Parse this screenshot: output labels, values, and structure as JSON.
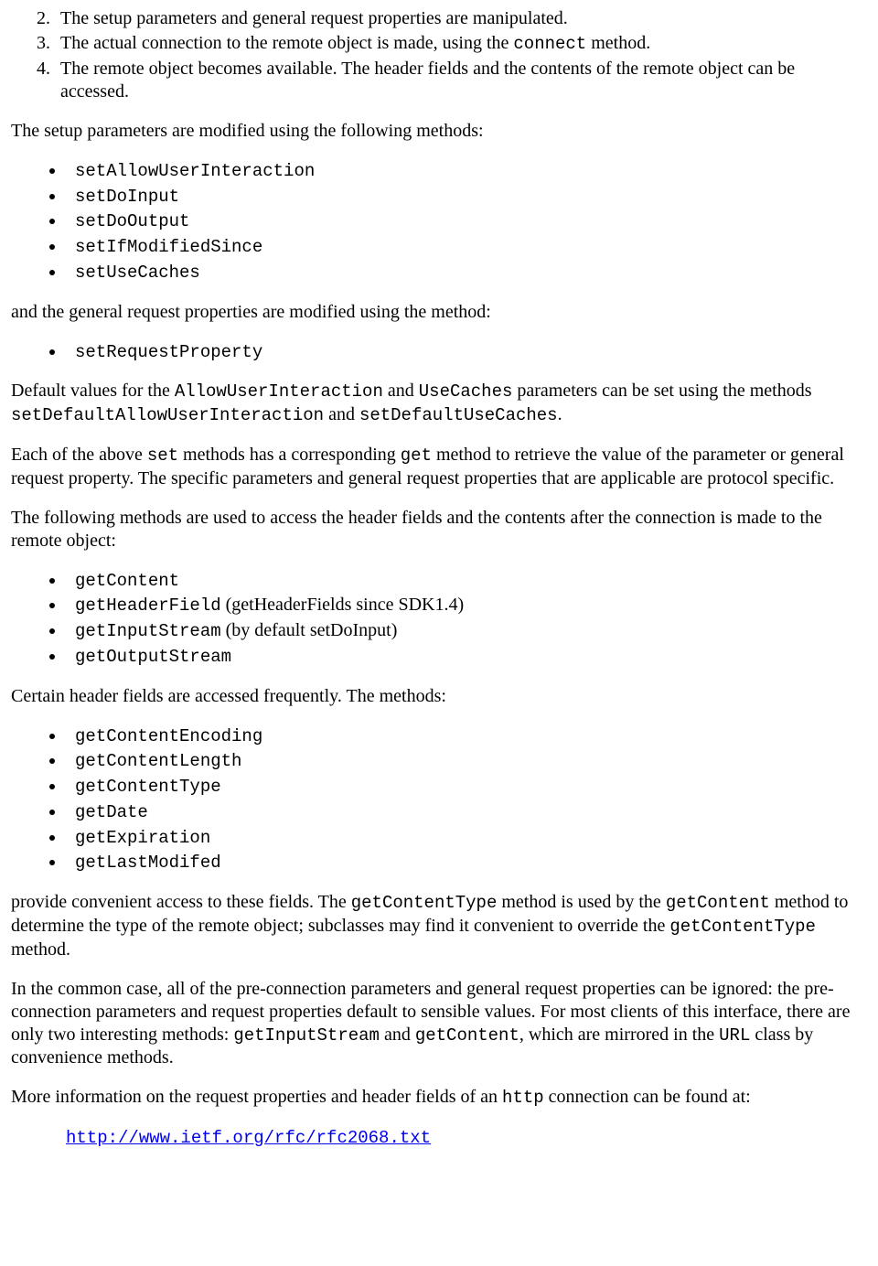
{
  "ordered": {
    "n2": "2.",
    "t2a": "The setup parameters and general request properties are manipulated.",
    "n3": "3.",
    "t3a": "The actual connection to the remote object is made, using the ",
    "t3b": "connect",
    "t3c": " method.",
    "n4": "4.",
    "t4a": "The remote object becomes available. The header fields and the contents of the remote object can be accessed."
  },
  "p1": "The setup parameters are modified using the following methods:",
  "setup_methods": [
    "setAllowUserInteraction",
    "setDoInput",
    "setDoOutput",
    "setIfModifiedSince",
    "setUseCaches"
  ],
  "p2": "and the general request properties are modified using the method:",
  "req_methods": [
    "setRequestProperty"
  ],
  "p3": {
    "a": "Default values for the ",
    "b": "AllowUserInteraction",
    "c": " and ",
    "d": "UseCaches",
    "e": " parameters can be set using the methods ",
    "f": "setDefaultAllowUserInteraction",
    "g": " and ",
    "h": "setDefaultUseCaches",
    "i": "."
  },
  "p4": {
    "a": "Each of the above ",
    "b": "set",
    "c": " methods has a corresponding ",
    "d": "get",
    "e": " method to retrieve the value of the parameter or general request property. The specific parameters and general request properties that are applicable are protocol specific."
  },
  "p5": "The following methods are used to access the header fields and the contents after the connection is made to the remote object:",
  "access_methods": {
    "m0": "getContent",
    "m1a": "getHeaderField",
    "m1b": " (getHeaderFields since SDK1.4)",
    "m2a": "getInputStream",
    "m2b": " (by default setDoInput)",
    "m3": "getOutputStream"
  },
  "p6": "Certain header fields are accessed frequently. The methods:",
  "header_methods": [
    "getContentEncoding",
    "getContentLength",
    "getContentType",
    "getDate",
    "getExpiration",
    "getLastModifed"
  ],
  "p7": {
    "a": "provide convenient access to these fields. The ",
    "b": "getContentType",
    "c": " method is used by the ",
    "d": "getContent",
    "e": " method to determine the type of the remote object; subclasses may find it convenient to override the ",
    "f": "getContentType",
    "g": " method."
  },
  "p8": {
    "a": "In the common case, all of the pre-connection parameters and general request properties can be ignored: the pre-connection parameters and request properties default to sensible values. For most clients of this interface, there are only two interesting methods: ",
    "b": "getInputStream",
    "c": " and ",
    "d": "getContent",
    "e": ", which are mirrored in the ",
    "f": "URL",
    "g": " class by convenience methods."
  },
  "p9": {
    "a": "More information on the request properties and header fields of an ",
    "b": "http",
    "c": " connection can be found at:"
  },
  "link": "http://www.ietf.org/rfc/rfc2068.txt"
}
